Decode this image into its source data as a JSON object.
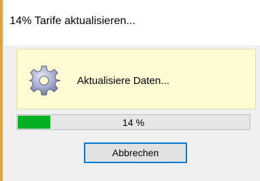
{
  "window": {
    "title": "14% Tarife aktualisieren..."
  },
  "info": {
    "icon": "gear-icon",
    "message": "Aktualisiere Daten..."
  },
  "progress": {
    "value_percent": 14,
    "label": "14 %",
    "fill_color": "#06b025"
  },
  "buttons": {
    "cancel_label": "Abbrechen"
  },
  "colors": {
    "info_background": "#fffbd3",
    "window_edge_accent": "#e3a23a"
  }
}
